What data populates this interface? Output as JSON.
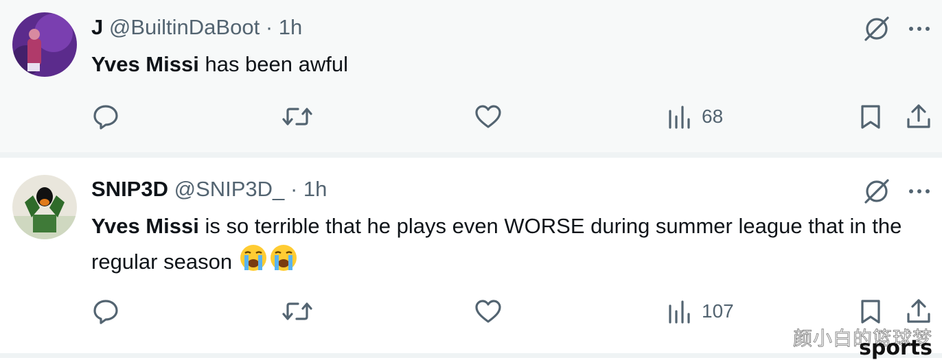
{
  "tweets": [
    {
      "display_name": "J",
      "handle": "@BuiltinDaBoot",
      "separator": "·",
      "time": "1h",
      "text_bold": "Yves Missi",
      "text_rest": " has been awful",
      "emojis": [],
      "views": "68",
      "icons": {
        "grok": "grok-slash-icon",
        "more": "more-dots-icon"
      }
    },
    {
      "display_name": "SNIP3D",
      "handle": "@SNIP3D_",
      "separator": "·",
      "time": "1h",
      "text_bold": "Yves Missi",
      "text_rest": " is so terrible that he plays even WORSE during summer league that in the regular season",
      "emojis": [
        "loudly-crying-face",
        "loudly-crying-face"
      ],
      "views": "107",
      "icons": {
        "grok": "grok-slash-icon",
        "more": "more-dots-icon"
      }
    }
  ],
  "action_icons": [
    "reply-icon",
    "retweet-icon",
    "like-icon",
    "views-icon",
    "bookmark-icon",
    "share-icon"
  ],
  "watermark": {
    "chinese": "颜小白的篮球梦",
    "english": "sports"
  },
  "colors": {
    "icon": "#536471",
    "text": "#0f1419",
    "muted": "#536471",
    "tweet1_bg": "#f7f9f9"
  }
}
